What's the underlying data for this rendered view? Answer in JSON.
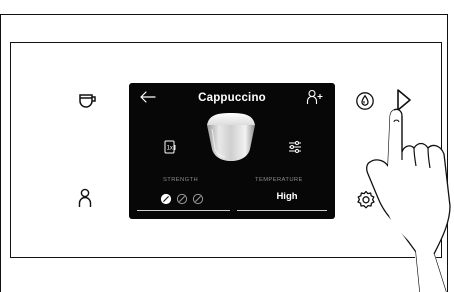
{
  "screen": {
    "title": "Cappuccino",
    "strength_label": "STRENGTH",
    "temperature_label": "TEMPERATURE",
    "temperature_value": "High",
    "strength_level": 1,
    "strength_max": 3
  },
  "icons": {
    "back": "arrow-left-icon",
    "add_profile": "add-person-icon",
    "drink": "cup-foam-icon",
    "shot": "single-shot-icon",
    "settings": "sliders-icon",
    "left_top": "cup-icon",
    "left_bottom": "person-icon",
    "right_top": "drop-icon",
    "right_play": "play-icon",
    "right_bottom": "gear-icon"
  },
  "colors": {
    "screen_bg": "#070707",
    "screen_text": "#ffffff",
    "label_gray": "#8c8c8c"
  }
}
